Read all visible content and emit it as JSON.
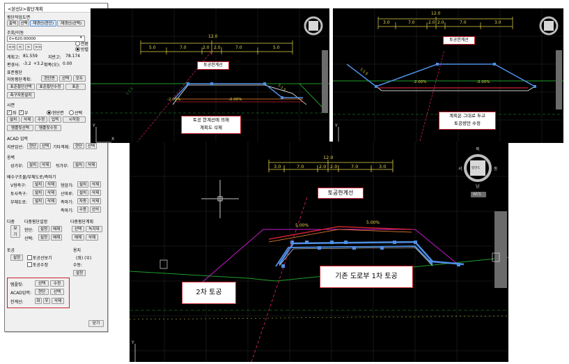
{
  "dialog": {
    "title": "<본선2>횡단계획",
    "section_plan_label": "횡단작업도면",
    "plan_buttons": [
      "출력",
      "선택",
      "재갱신(현단)",
      "재갱신(선택)"
    ],
    "lookup_label": "조회/이동",
    "station_value": "0+620.00000",
    "nav_buttons": [
      "<<",
      "<",
      ">",
      ">>"
    ],
    "radio_prev": "전환",
    "radio_apply": "방렬",
    "plan_height_label": "계획고:",
    "plan_height_value": "81.559",
    "ground_height_label": "지반고:",
    "ground_height_value": "78.174",
    "slope_label": "편경사:",
    "slope_left": "-3.2",
    "slope_right": "+3.2",
    "widen_label": "확폭(오):",
    "widen_value": "0.00",
    "std_section_label": "표준횡단",
    "auto_section_label": "자동횡단계획:",
    "auto_buttons": [
      "현단면",
      "선택",
      "모두"
    ],
    "std_buttons": [
      "표준횡단선택",
      "표준횡단수정",
      "표준"
    ],
    "measure_button": "측구자동설치",
    "slope_section_label": "사면",
    "check_left": "좌",
    "check_right": "우",
    "radio_current": "현단면",
    "radio_select": "선택",
    "slope_buttons": [
      "설치",
      "삭제",
      "수정",
      "입력",
      "시작점"
    ],
    "template_buttons": [
      "템플릿선택",
      "템플릿수정"
    ],
    "acad_input_label": "ACAD 입력",
    "ground_line_label": "지반암선:",
    "ground_line_buttons": [
      "현단",
      "선택"
    ],
    "other_label": "기타객체:",
    "other_buttons": [
      "현단",
      "선택"
    ],
    "retaining_label": "옹벽",
    "cut_label": "성가부:",
    "fill_label": "뒤가부:",
    "install_delete": [
      "설치",
      "삭제"
    ],
    "drain_label": "배수구조물/부체도로/측마기",
    "v_ditch_label": "V형측구:",
    "toe_label": "형암가:",
    "soil_label": "토사측구:",
    "berm_label": "산마루:",
    "side_road_label": "부체도로:",
    "side1_label": "측마기:",
    "side2_label": "측마기:",
    "auto_edit": [
      "자동",
      "삭제"
    ],
    "edit_delete": [
      "수동",
      "선삭"
    ],
    "multi_label": "다중",
    "multi_section_label": "다중횡단설정",
    "multi_plan_label": "다중횡단계획",
    "view_button": "보기",
    "current_label": "현단:",
    "select_label": "선택:",
    "set_release": [
      "설정",
      "해제"
    ],
    "select_vertical": [
      "선택",
      "녹지대"
    ],
    "release_delete": [
      "해제",
      "삭제"
    ],
    "earthwork_label": "토공",
    "setting_button": "설정",
    "earth_line_check": "토공선보기",
    "earth_edit_check": "토공수정",
    "green_label": "용지",
    "green_edit_label": "수동:",
    "left_right_label": "(좌)  (우)",
    "green_setting_button": "설정",
    "template_label": "템플릿:",
    "template_row_buttons": [
      "선택",
      "수정"
    ],
    "acad_row_label": "ACAD입력:",
    "acad_row_buttons": [
      "현단",
      "선택"
    ],
    "limit_label": "한계선:",
    "limit_buttons": [
      "좌",
      "우",
      "삭제"
    ],
    "close_button": "닫기"
  },
  "pane1": {
    "dims_top": "12.0",
    "dims_mid": [
      "5.0",
      "7.0",
      "2.0",
      "2.0",
      "7.0",
      "5.0"
    ],
    "limit_note": "토공한계선",
    "slope_label_left": "1:1.5",
    "slope_label_right": "1:1.5",
    "pct_left": "-2.00%",
    "pct_right": "-2.00%",
    "callout": [
      "토공 한계선에 의해",
      "계획도 삭제"
    ],
    "axis_y": "Y",
    "axis_x": "X"
  },
  "pane2": {
    "dims_top": "12.0",
    "dims_mid": [
      "3.0",
      "7.0",
      "2.0",
      "2.0",
      "7.0",
      "3.0"
    ],
    "limit_note": "토공한계선",
    "slope_label": "1:1.5",
    "pct_left": "-2.00%",
    "pct_right": "-2.00%",
    "callout": [
      "계획은 그대로 두고",
      "토공량만 수정"
    ],
    "axis_y": "Y"
  },
  "pane3": {
    "dims_top": "12.0",
    "dims_mid": [
      "3.0",
      "7.0",
      "2.0",
      "2.0",
      "7.0",
      "3.0"
    ],
    "limit_note": "토공한계선",
    "pct_left": "5.00%",
    "pct_right": "5.00%",
    "callout_left": "2차 토공",
    "callout_right": "기존 도로부  1차 토공",
    "compass_n": "북",
    "compass_s": "남",
    "compass_e": "동",
    "compass_w": "서",
    "compass_center": "평면도",
    "wcs_label": "WCS",
    "axis_y": "Y"
  },
  "colors": {
    "highlight_box": "#c9222f",
    "road_line": "#4f8fe6",
    "ground_line": "#1f9e2a",
    "dim_line": "#e6d84a",
    "limit_line": "#d0206c"
  }
}
